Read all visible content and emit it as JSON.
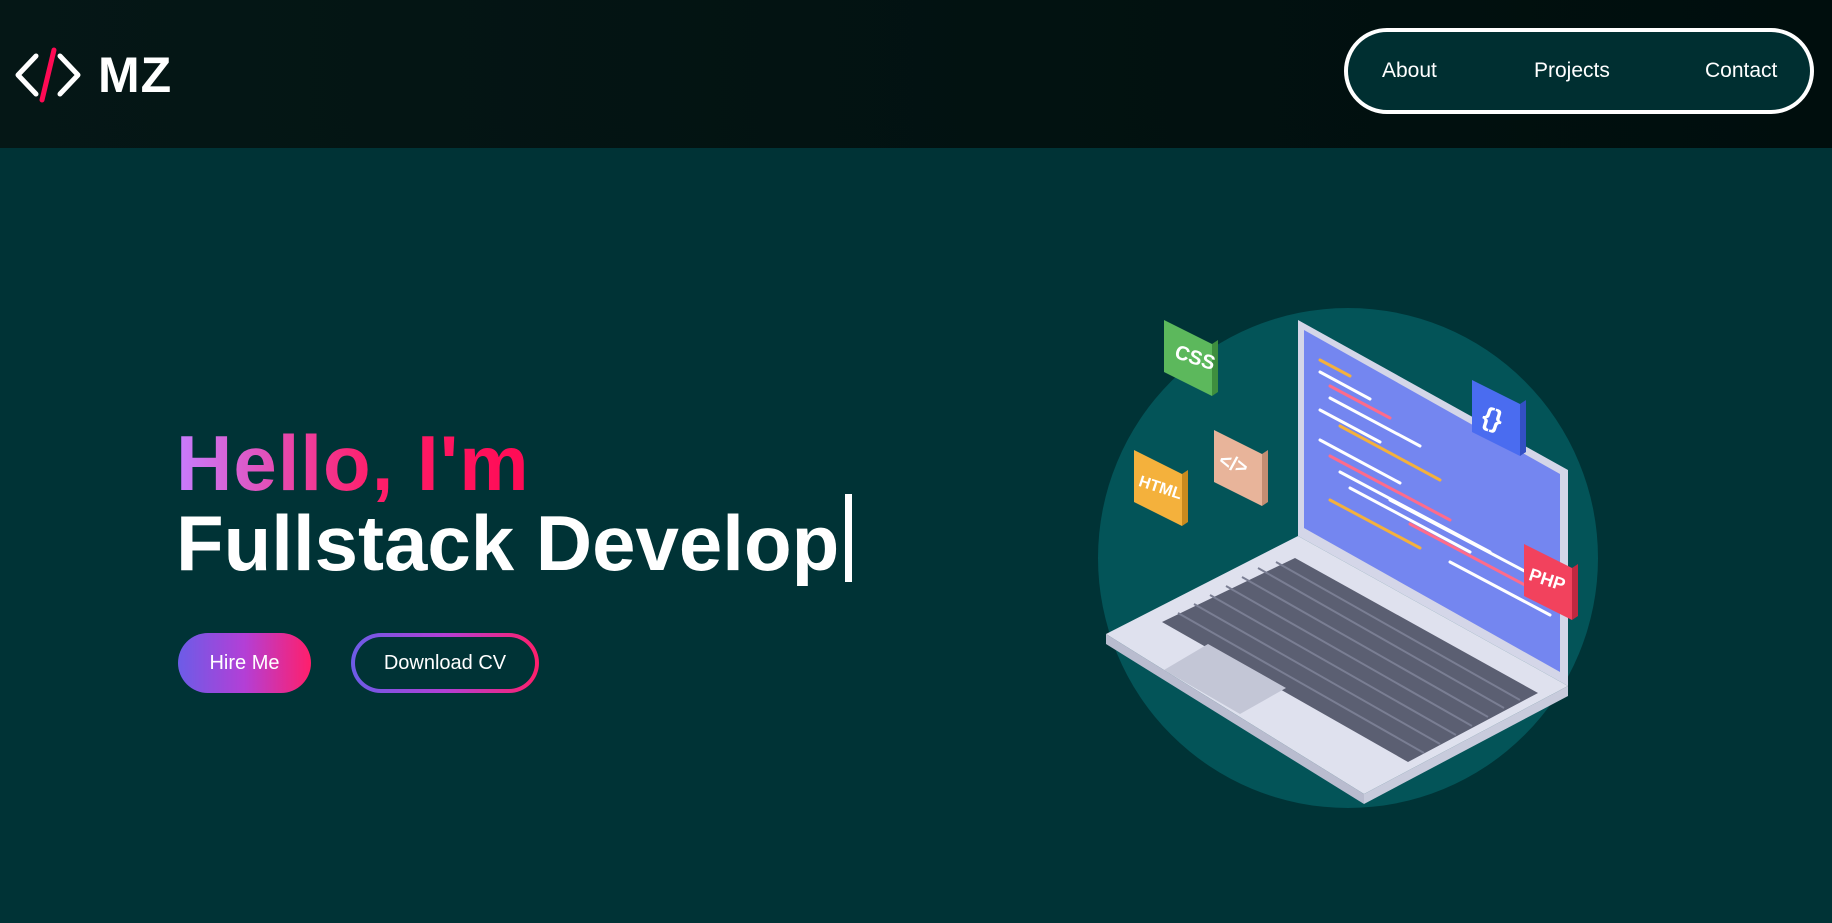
{
  "header": {
    "logo_text": "MZ",
    "nav": [
      {
        "label": "About"
      },
      {
        "label": "Projects"
      },
      {
        "label": "Contact"
      }
    ]
  },
  "hero": {
    "greeting": "Hello, I'm",
    "role_typed": "Fullstack Develop",
    "hire_label": "Hire Me",
    "cv_label": "Download CV"
  },
  "illustration": {
    "badges": [
      {
        "label": "CSS",
        "color": "#5cb85c"
      },
      {
        "label": "HTML",
        "color": "#f4b13c"
      },
      {
        "label": "</>",
        "color": "#e8b49a"
      },
      {
        "label": "{}",
        "color": "#4a6cf0"
      },
      {
        "label": "PHP",
        "color": "#f2425d"
      }
    ]
  },
  "colors": {
    "background": "#003336",
    "header": "#051716",
    "accent_pink": "#ff0a54",
    "accent_purple": "#c77dff",
    "circle": "#035458"
  }
}
